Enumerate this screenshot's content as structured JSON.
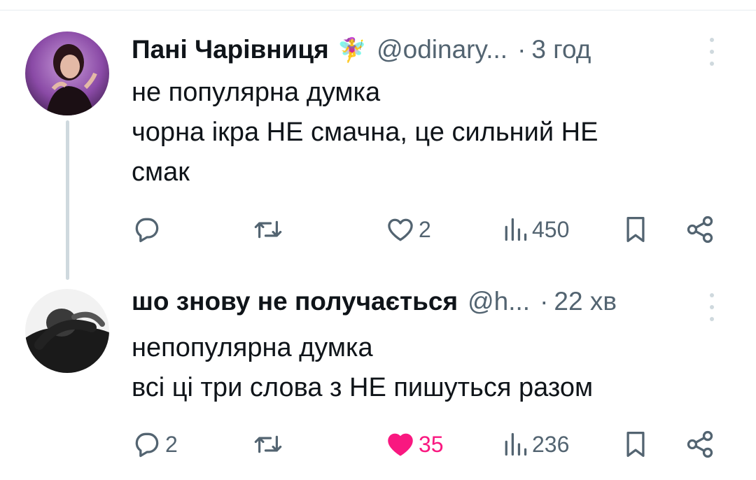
{
  "tweets": [
    {
      "display_name": "Пані Чарівниця",
      "emoji": "🧚‍♀️",
      "handle": "@odinary...",
      "dot": "·",
      "time": "3 год",
      "lines": [
        "не популярна думка",
        "чорна ікра НЕ смачна, це сильний НЕ",
        "смак"
      ],
      "actions": {
        "replies": "",
        "retweets": "",
        "likes": "2",
        "views": "450"
      },
      "liked": false
    },
    {
      "display_name": "шо знову не получається",
      "emoji": "",
      "handle": "@h...",
      "dot": "·",
      "time": "22 хв",
      "lines": [
        "непопулярна думка",
        "всі ці три слова з НЕ пишуться разом"
      ],
      "actions": {
        "replies": "2",
        "retweets": "",
        "likes": "35",
        "views": "236"
      },
      "liked": true
    }
  ],
  "colors": {
    "text": "#0f1419",
    "secondary": "#536471",
    "like_active": "#f91880",
    "thread_line": "#cfd9de"
  },
  "icons": [
    "reply-icon",
    "retweet-icon",
    "like-icon",
    "views-icon",
    "bookmark-icon",
    "share-icon",
    "more-icon"
  ]
}
